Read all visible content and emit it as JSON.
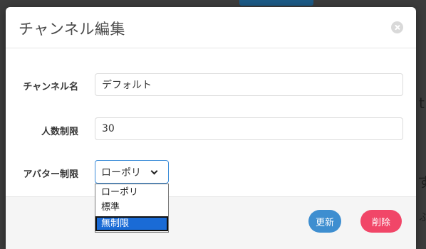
{
  "modal": {
    "title": "チャンネル編集"
  },
  "form": {
    "channel_name": {
      "label": "チャンネル名",
      "value": "デフォルト"
    },
    "user_limit": {
      "label": "人数制限",
      "value": "30"
    },
    "avatar_limit": {
      "label": "アバター制限",
      "selected": "ローポリ",
      "options": [
        "ローポリ",
        "標準",
        "無制限"
      ],
      "highlighted_option": "無制限"
    }
  },
  "footer": {
    "update_label": "更新",
    "delete_label": "削除"
  },
  "colors": {
    "update": "#3e8ed0",
    "delete": "#f14668",
    "dropdown_highlight": "#1a6bd6",
    "overlay": "#3c3c3c"
  }
}
